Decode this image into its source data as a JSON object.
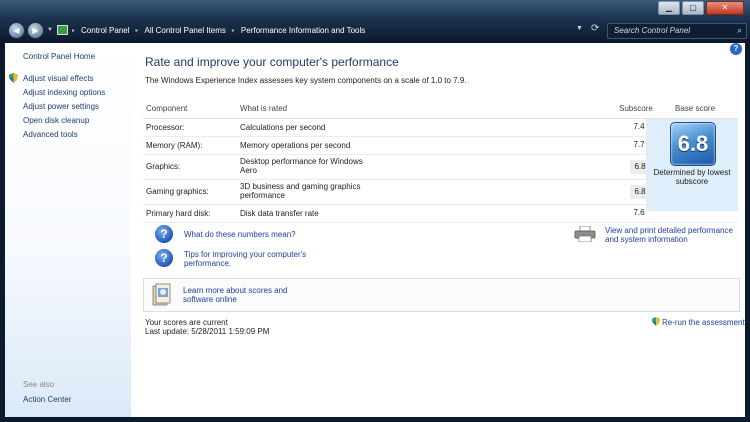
{
  "window": {
    "minimize": "▁",
    "maximize": "▢",
    "close": "✕"
  },
  "nav": {
    "back": "◀",
    "forward": "▶"
  },
  "breadcrumb": [
    "Control Panel",
    "All Control Panel Items",
    "Performance Information and Tools"
  ],
  "search": {
    "placeholder": "Search Control Panel"
  },
  "sidebar": {
    "home": "Control Panel Home",
    "items": [
      {
        "label": "Adjust visual effects"
      },
      {
        "label": "Adjust indexing options"
      },
      {
        "label": "Adjust power settings"
      },
      {
        "label": "Open disk cleanup"
      },
      {
        "label": "Advanced tools"
      }
    ],
    "see_also": "See also",
    "action_center": "Action Center"
  },
  "main": {
    "title": "Rate and improve your computer's performance",
    "intro": "The Windows Experience Index assesses key system components on a scale of 1.0 to 7.9.",
    "table": {
      "headers": {
        "component": "Component",
        "what": "What is rated",
        "subscore": "Subscore",
        "base": "Base score"
      },
      "rows": [
        {
          "component": "Processor:",
          "what": "Calculations per second",
          "subscore": "7.4"
        },
        {
          "component": "Memory (RAM):",
          "what": "Memory operations per second",
          "subscore": "7.7"
        },
        {
          "component": "Graphics:",
          "what": "Desktop performance for Windows Aero",
          "subscore": "6.8"
        },
        {
          "component": "Gaming graphics:",
          "what": "3D business and gaming graphics performance",
          "subscore": "6.8"
        },
        {
          "component": "Primary hard disk:",
          "what": "Disk data transfer rate",
          "subscore": "7.6"
        }
      ],
      "base_score": "6.8",
      "base_caption": "Determined by lowest subscore"
    },
    "links": {
      "numbers": "What do these numbers mean?",
      "tips": "Tips for improving your computer's performance.",
      "print": "View and print detailed performance and system information",
      "learn": "Learn more about scores and software online"
    },
    "status": {
      "current": "Your scores are current",
      "last_update": "Last update: 5/28/2011 1:59:09 PM"
    },
    "rerun": "Re-run the assessment"
  },
  "colors": {
    "link": "#1e3e9e",
    "title": "#1e3a6e",
    "base_bg": "#dfeefb"
  }
}
